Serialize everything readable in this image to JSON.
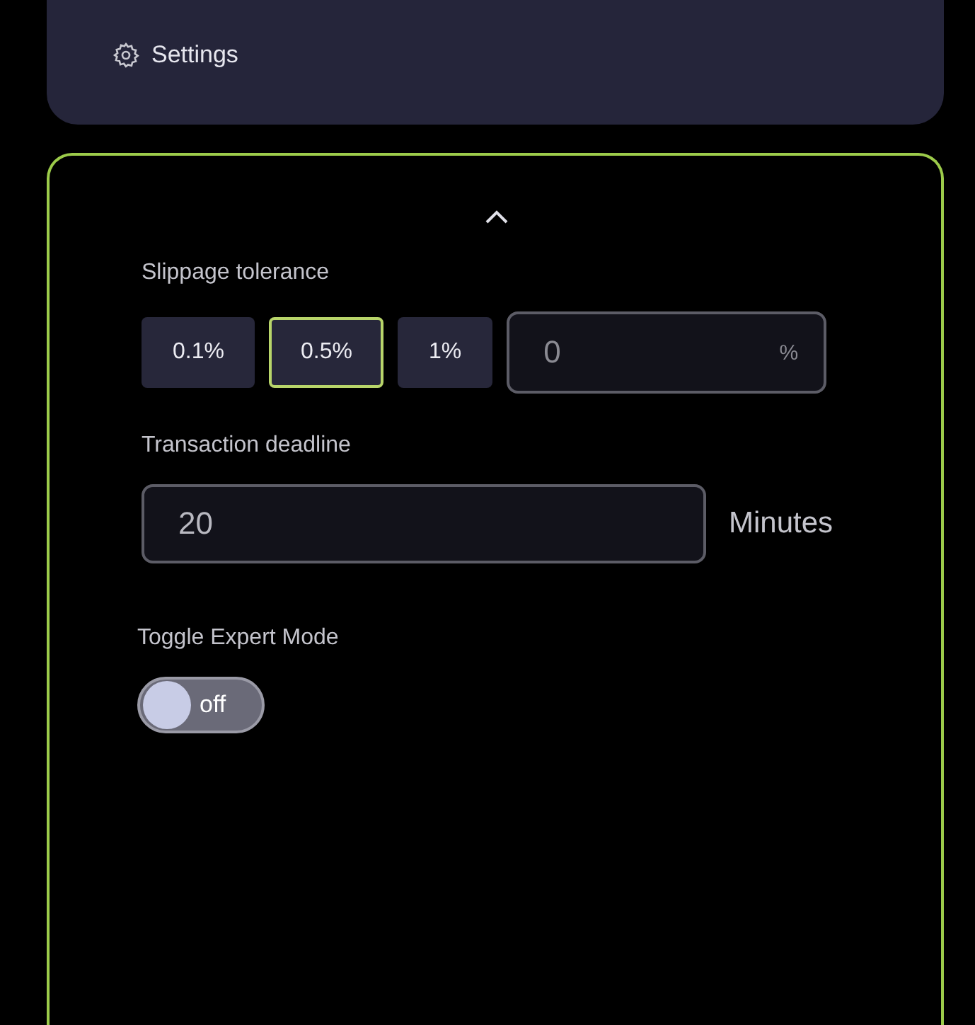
{
  "settings_card": {
    "label": "Settings"
  },
  "panel": {
    "expanded": true,
    "slippage": {
      "label": "Slippage tolerance",
      "options": [
        {
          "label": "0.1%",
          "selected": false
        },
        {
          "label": "0.5%",
          "selected": true
        },
        {
          "label": "1%",
          "selected": false
        }
      ],
      "custom": {
        "placeholder": "0",
        "unit": "%"
      }
    },
    "deadline": {
      "label": "Transaction deadline",
      "value": "20",
      "unit": "Minutes"
    },
    "expert_mode": {
      "label": "Toggle Expert Mode",
      "on": false,
      "state_text": "off"
    }
  }
}
